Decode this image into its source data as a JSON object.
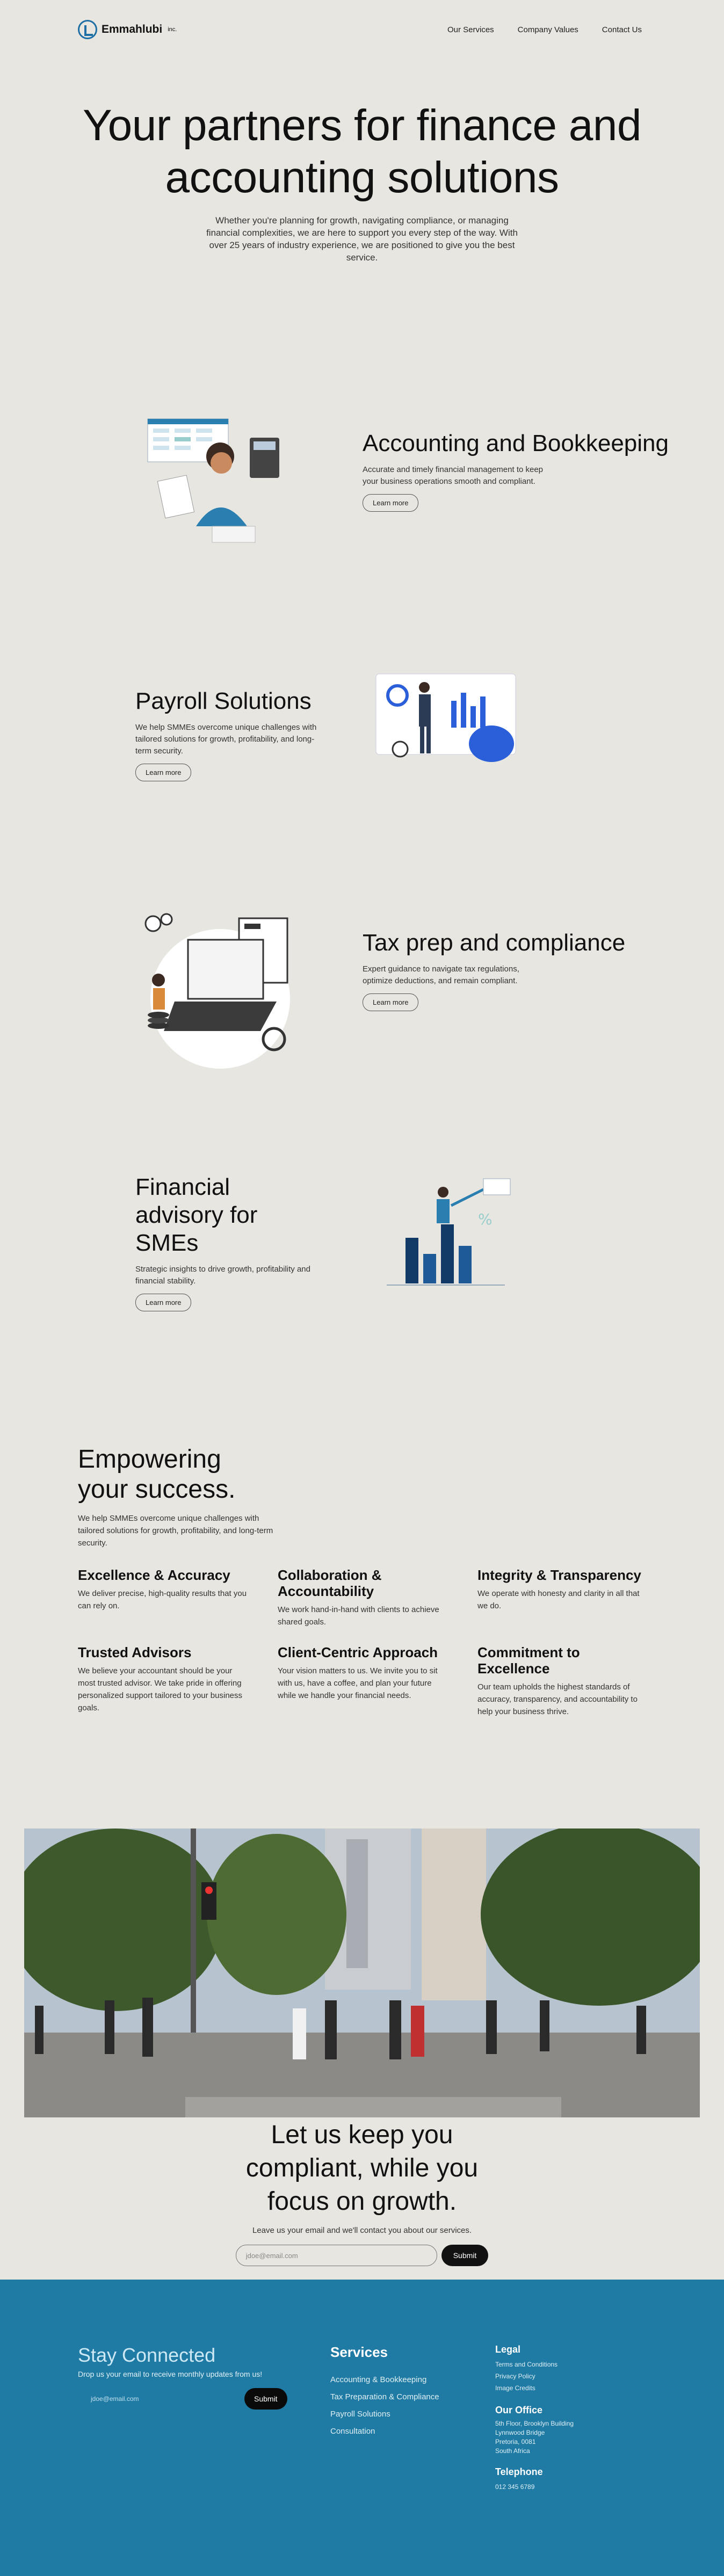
{
  "nav": {
    "brand": "Emmahlubi",
    "brand_suffix": "inc.",
    "links": [
      "Our Services",
      "Company Values",
      "Contact Us"
    ]
  },
  "hero": {
    "title": "Your partners for finance and accounting solutions",
    "subtitle": "Whether you're planning for growth, navigating compliance, or managing financial complexities, we are here to support you every step of the way. With over 25 years of industry experience, we are positioned to give you the best service."
  },
  "services": [
    {
      "title": "Accounting and Bookkeeping",
      "desc": "Accurate and timely financial management to keep your business operations smooth and compliant.",
      "button": "Learn more"
    },
    {
      "title": "Payroll Solutions",
      "desc": "We help SMMEs overcome unique challenges with tailored solutions for growth, profitability, and long-term security.",
      "button": "Learn more"
    },
    {
      "title": "Tax prep and compliance",
      "desc": "Expert guidance to navigate tax regulations, optimize deductions, and remain compliant.",
      "button": "Learn more"
    },
    {
      "title": "Financial advisory for SMEs",
      "desc": "Strategic insights to drive growth, profitability and financial stability.",
      "button": "Learn more"
    }
  ],
  "values": {
    "title": "Empowering your success.",
    "subtitle": "We help SMMEs overcome unique challenges with tailored solutions for growth, profitability, and long-term security.",
    "items": [
      {
        "title": "Excellence & Accuracy",
        "desc": "We deliver precise, high-quality results that you can rely on."
      },
      {
        "title": "Collaboration & Accountability",
        "desc": "We work hand-in-hand with clients to achieve shared goals."
      },
      {
        "title": "Integrity & Transparency",
        "desc": "We operate with honesty and clarity in all that we do."
      },
      {
        "title": "Trusted Advisors",
        "desc": "We believe your accountant should be your most trusted advisor. We take pride in offering personalized support tailored to your business goals."
      },
      {
        "title": "Client-Centric Approach",
        "desc": "Your vision matters to us. We invite you to sit with us, have a coffee, and plan your future while we handle your financial needs."
      },
      {
        "title": "Commitment to Excellence",
        "desc": "Our team upholds the highest standards of accuracy, transparency, and accountability to help your business thrive."
      }
    ]
  },
  "cta": {
    "title": "Let us keep you compliant, while you focus on growth.",
    "subtitle": "Leave us your email and we'll contact you about our services.",
    "placeholder": "jdoe@email.com",
    "button": "Submit"
  },
  "footer": {
    "title": "Stay Connected",
    "subtitle": "Drop us your email to receive monthly updates from us!",
    "placeholder": "jdoe@email.com",
    "button": "Submit",
    "services_title": "Services",
    "services": [
      "Accounting & Bookkeeping",
      "Tax Preparation & Compliance",
      "Payroll Solutions",
      "Consultation"
    ],
    "legal_title": "Legal",
    "legal": [
      "Terms and Conditions",
      "Privacy Policy",
      "Image Credits"
    ],
    "office_title": "Our Office",
    "office": [
      "5th Floor, Brooklyn Building",
      "Lynnwood Bridge",
      "Pretoria, 0081",
      "South Africa"
    ],
    "phone_title": "Telephone",
    "phone": "012 345 6789"
  },
  "colors": {
    "background": "#e8e6e1",
    "footer": "#1f7aa4",
    "accent": "#1d6fa5"
  }
}
